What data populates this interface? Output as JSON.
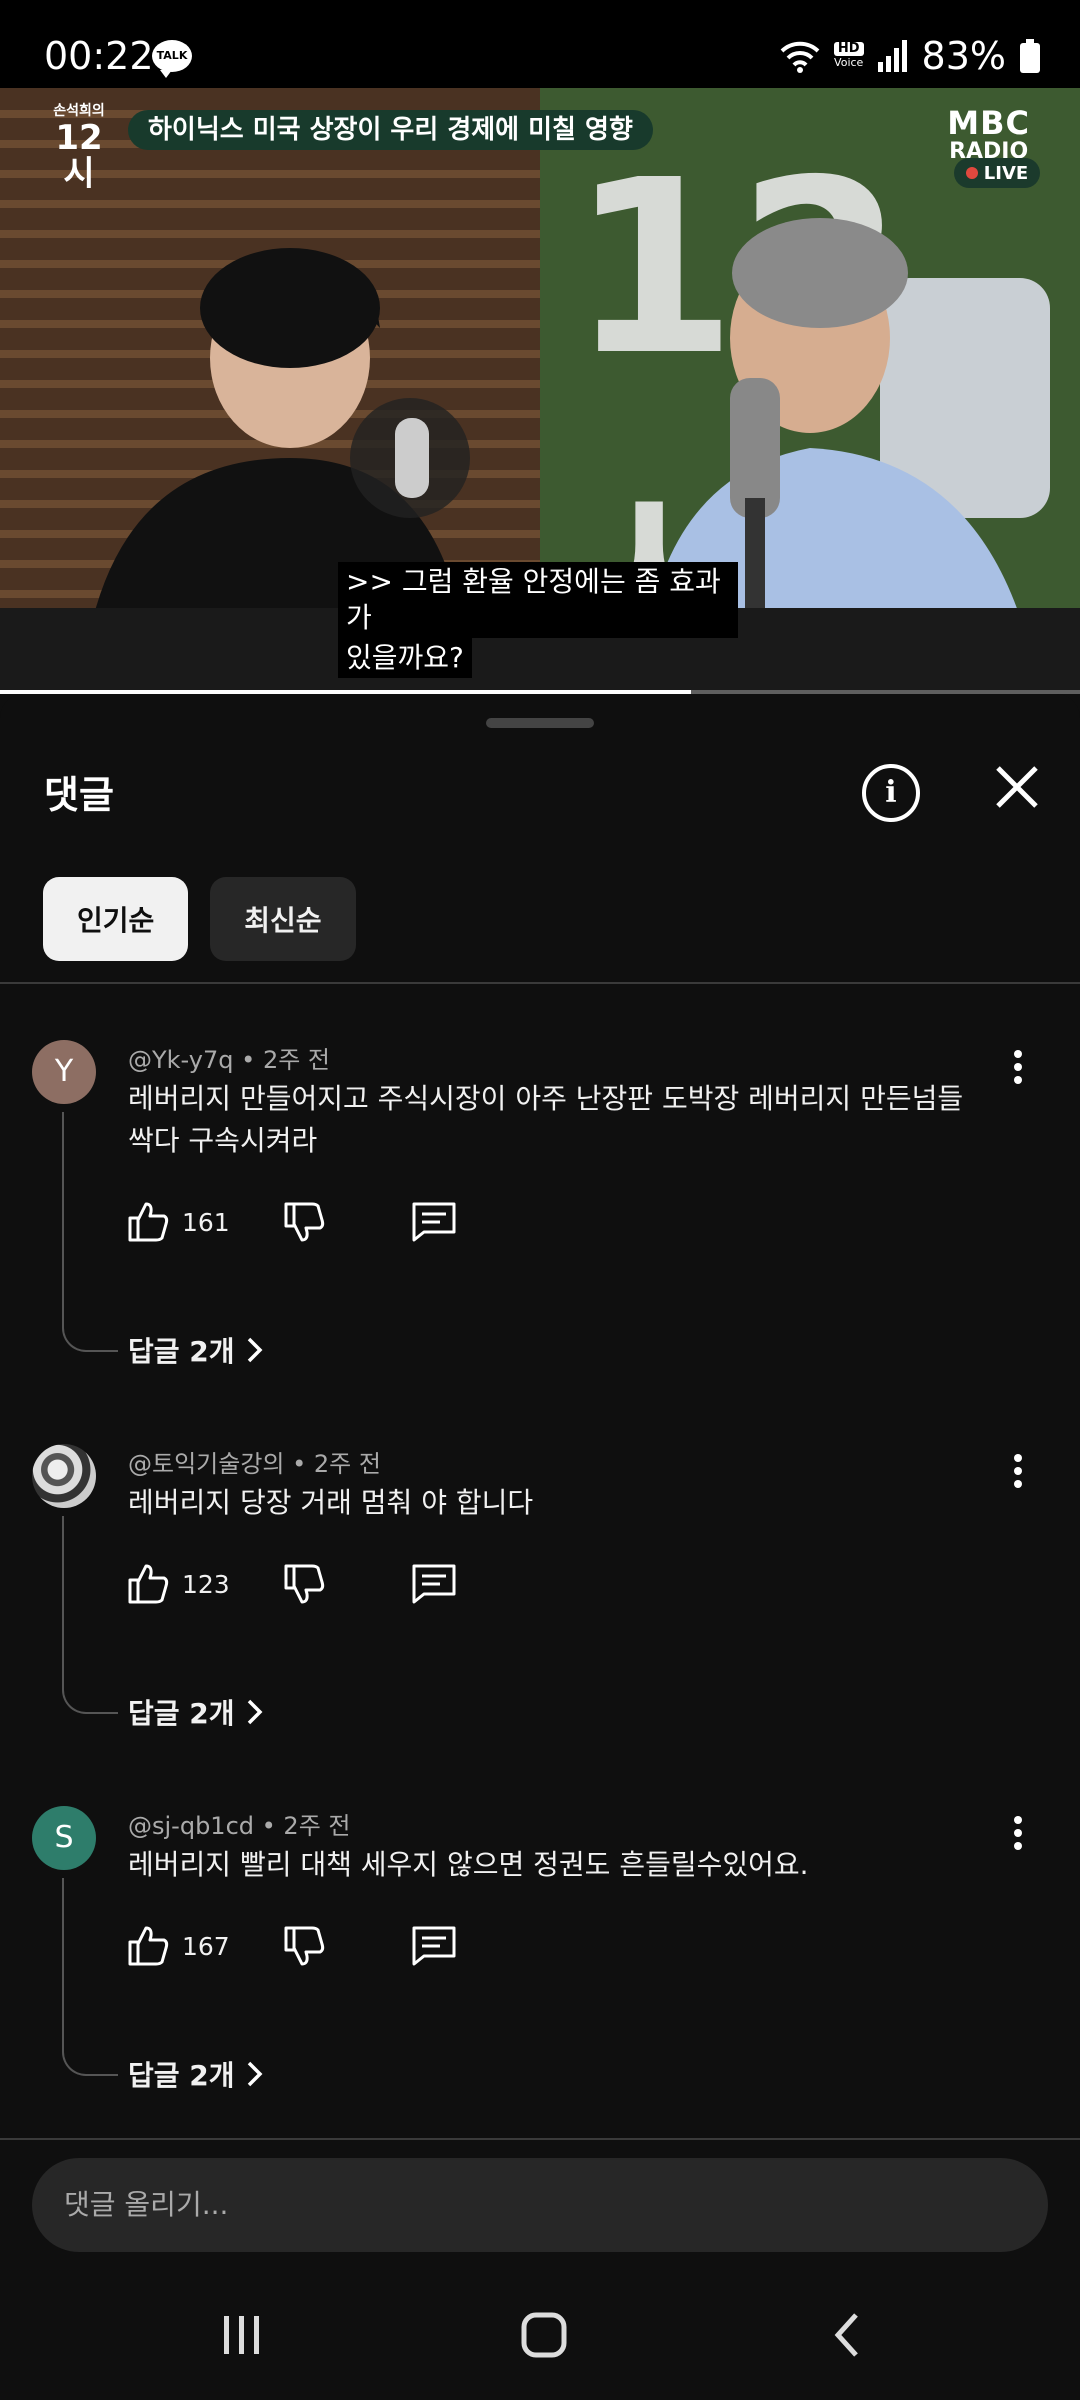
{
  "status_bar": {
    "time": "00:22",
    "talk_badge": "TALK",
    "hd_label": "HD",
    "voice_label": "Voice",
    "battery": "83%"
  },
  "video": {
    "show_logo_top": "손석희의",
    "show_logo_main": "12시",
    "title": "하이닉스 미국 상장이 우리 경제에 미칠 영향",
    "broadcaster": "MBC",
    "broadcaster_sub": "RADIO",
    "live_label": "LIVE",
    "studio_sign": "12시",
    "caption_line1": ">> 그럼 환율 안정에는 좀 효과가",
    "caption_line2": "있을까요?",
    "progress": 0.64
  },
  "panel": {
    "title": "댓글",
    "sort_chips": [
      "인기순",
      "최신순"
    ],
    "active_chip": "인기순",
    "add_comment_placeholder": "댓글 올리기..."
  },
  "comments": [
    {
      "author": "@Yk-y7q",
      "time": "2주 전",
      "avatar_letter": "Y",
      "avatar_color": "#8d6e63",
      "text": "레버리지 만들어지고 주식시장이 아주 난장판 도박장 레버리지 만든넘들 싹다 구속시켜라",
      "likes": "161",
      "replies": "답글 2개"
    },
    {
      "author": "@토익기술강의",
      "time": "2주 전",
      "avatar_letter": "",
      "avatar_color": "#cccccc",
      "text": "레버리지 당장 거래 멈춰 야 합니다",
      "likes": "123",
      "replies": "답글 2개"
    },
    {
      "author": "@sj-qb1cd",
      "time": "2주 전",
      "avatar_letter": "S",
      "avatar_color": "#2e7d6b",
      "text": "레버리지 빨리 대책 세우지 않으면  정권도 흔들릴수있어요.",
      "likes": "167",
      "replies": "답글 2개"
    }
  ],
  "icons": [
    "talk-icon",
    "wifi-icon",
    "signal-icon",
    "battery-icon",
    "info-icon",
    "close-icon",
    "like-icon",
    "dislike-icon",
    "reply-icon",
    "more-icon",
    "chevron-right-icon",
    "recents-icon",
    "home-icon",
    "back-icon"
  ]
}
